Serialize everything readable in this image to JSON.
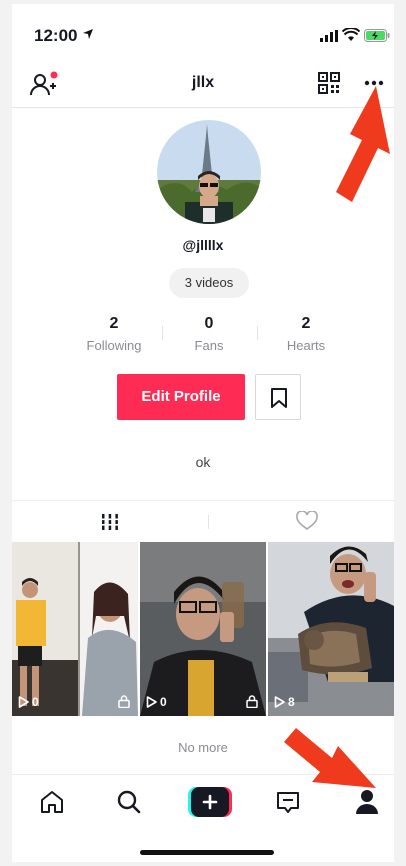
{
  "status_bar": {
    "time": "12:00"
  },
  "header": {
    "title": "jllx"
  },
  "profile": {
    "username": "@jllllx",
    "videos_pill": "3 videos",
    "stats": [
      {
        "value": "2",
        "label": "Following"
      },
      {
        "value": "0",
        "label": "Fans"
      },
      {
        "value": "2",
        "label": "Hearts"
      }
    ],
    "edit_button": "Edit Profile",
    "bio": "ok"
  },
  "videos": [
    {
      "views": "0",
      "locked": false
    },
    {
      "views": "0",
      "locked": true
    },
    {
      "views": "8",
      "locked": false
    }
  ],
  "no_more": "No more",
  "colors": {
    "accent": "#fe2c55",
    "arrow": "#f03a1d",
    "text": "#161823",
    "muted": "#8a8b91"
  },
  "icons": [
    "add-user-icon",
    "qr-code-icon",
    "more-icon",
    "bookmark-icon",
    "grid-icon",
    "heart-icon",
    "play-icon",
    "lock-icon",
    "home-icon",
    "search-icon",
    "create-icon",
    "inbox-icon",
    "profile-icon"
  ]
}
